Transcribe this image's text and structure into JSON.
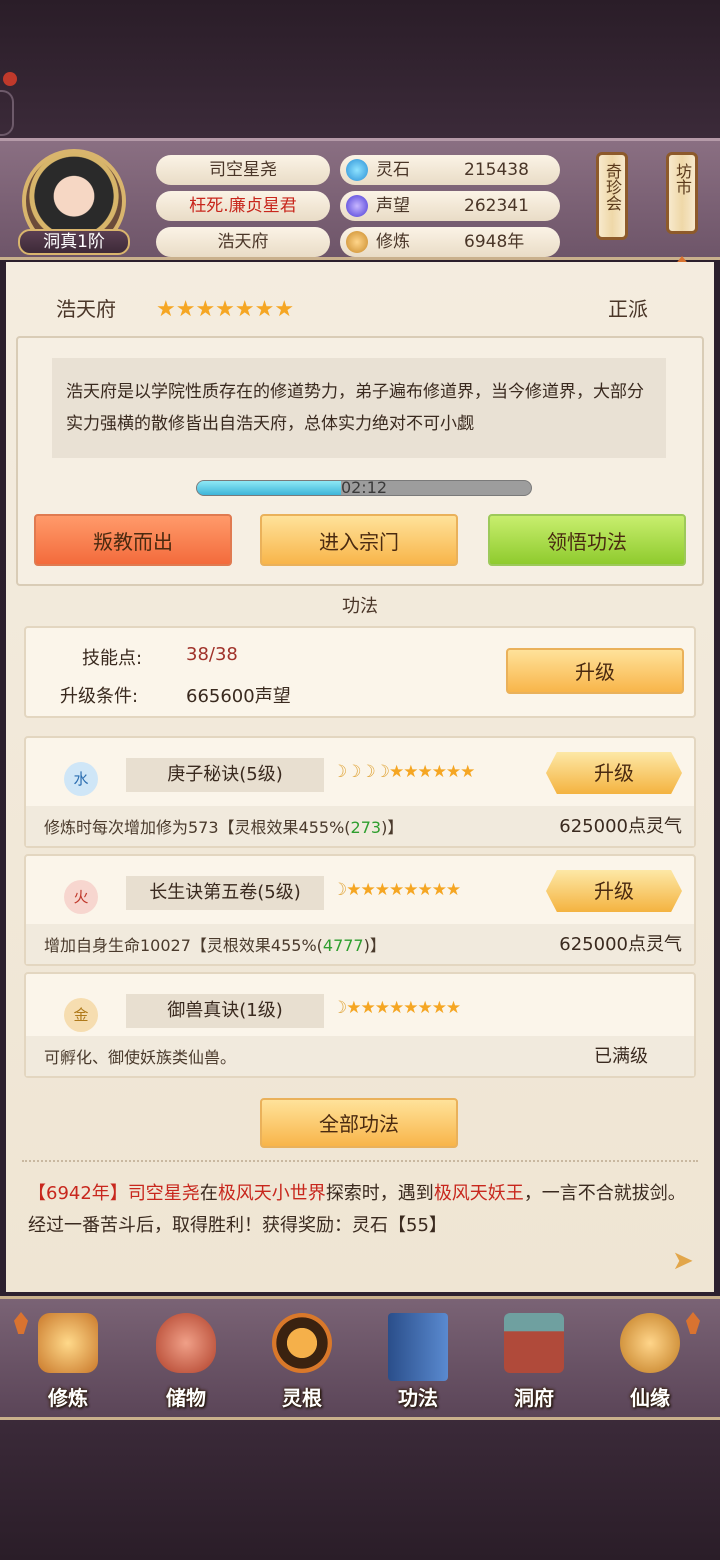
{
  "header": {
    "rank_label": "洞真1阶",
    "player_name": "司空星尧",
    "title": "枉死.廉贞星君",
    "sect": "浩天府",
    "stats": [
      {
        "label": "灵石",
        "value": "215438",
        "icon": "spirit-stone-icon"
      },
      {
        "label": "声望",
        "value": "262341",
        "icon": "reputation-icon"
      },
      {
        "label": "修炼",
        "value": "6948年",
        "icon": "cultivation-icon"
      }
    ],
    "shop1": "奇珍会",
    "shop2": "坊市"
  },
  "sect": {
    "name": "浩天府",
    "stars": 7,
    "alignment": "正派",
    "description": "浩天府是以学院性质存在的修道势力，弟子遍布修道界，当今修道界，大部分实力强横的散修皆出自浩天府，总体实力绝对不可小觑",
    "timer": "02:12",
    "timer_progress": 0.43,
    "buttons": {
      "leave": "叛教而出",
      "enter": "进入宗门",
      "learn": "领悟功法"
    }
  },
  "skills_section": {
    "title": "功法",
    "points_label": "技能点:",
    "points_value": "38/38",
    "upgrade_label": "升级条件:",
    "upgrade_value": "665600声望",
    "upgrade_button": "升级",
    "items": [
      {
        "element": "水",
        "name": "庚子秘诀(5级)",
        "moons": 4,
        "stars": 6,
        "effect_a": "修炼时每次增加修为573【灵根效果455%(",
        "effect_b": "273",
        "effect_c": ")】",
        "cost": "625000点灵气",
        "button": "升级"
      },
      {
        "element": "火",
        "name": "长生诀第五卷(5级)",
        "moons": 1,
        "stars": 8,
        "effect_a": "增加自身生命10027【灵根效果455%(",
        "effect_b": "4777",
        "effect_c": ")】",
        "cost": "625000点灵气",
        "button": "升级"
      },
      {
        "element": "金",
        "name": "御兽真诀(1级)",
        "moons": 1,
        "stars": 8,
        "effect": "可孵化、御使妖族类仙兽。",
        "status": "已满级"
      }
    ],
    "all_button": "全部功法"
  },
  "log": {
    "year": "【6942年】",
    "actor": "司空星尧",
    "t1": "在",
    "place": "极风天小世界",
    "t2": "探索时，遇到",
    "enemy": "极风天妖王",
    "t3": "，一言不合就拔剑。经过一番苦斗后，取得胜利！获得奖励：灵石【55】"
  },
  "nav": [
    {
      "label": "修炼",
      "icon": "cultivate-monk-icon",
      "color": "#e0a040"
    },
    {
      "label": "储物",
      "icon": "storage-bag-icon",
      "color": "#c2503a"
    },
    {
      "label": "灵根",
      "icon": "spirit-root-icon",
      "color": "#d9782a"
    },
    {
      "label": "功法",
      "icon": "skill-book-icon",
      "color": "#3a6db0"
    },
    {
      "label": "洞府",
      "icon": "cave-house-icon",
      "color": "#b04a3a"
    },
    {
      "label": "仙缘",
      "icon": "gourd-icon",
      "color": "#d48a2a"
    }
  ]
}
